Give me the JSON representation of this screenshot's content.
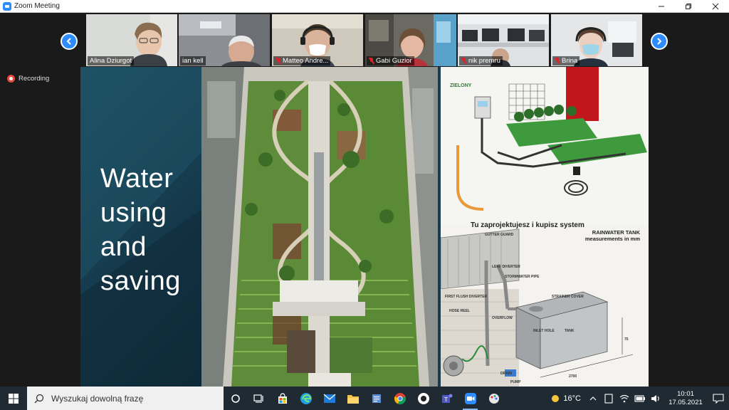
{
  "window": {
    "title": "Zoom Meeting"
  },
  "participants": [
    {
      "name": "Alina Dziurgot",
      "muted": false
    },
    {
      "name": "ian kell",
      "muted": false
    },
    {
      "name": "Matteo Andre...",
      "muted": true
    },
    {
      "name": "Gabi Guzior",
      "muted": true
    },
    {
      "name": "nik premru",
      "muted": true
    },
    {
      "name": "Brina",
      "muted": true
    }
  ],
  "recording": {
    "label": "Recording"
  },
  "slide": {
    "title_lines": [
      "Water",
      "using",
      "and",
      "saving"
    ],
    "diagram_top_caption": "Tu zaprojektujesz i kupisz system",
    "diagram_top_brand": "ZIELONY",
    "diagram_bottom_title": "RAINWATER TANK",
    "diagram_bottom_subtitle": "measurements in mm",
    "tank_labels": [
      "GUTTER GUARD",
      "LEAF DIVERTER",
      "STORMWATER PIPE",
      "FIRST FLUSH DIVERTER",
      "HOSE REEL",
      "OVERFLOW",
      "STRAINER COVER",
      "INLET HOLE",
      "TANK",
      "DRAIN",
      "PUMP",
      "2700",
      "75"
    ]
  },
  "taskbar": {
    "search_placeholder": "Wyszukaj dowolną frazę",
    "temperature": "16°C",
    "time": "10:01",
    "date": "17.05.2021"
  },
  "colors": {
    "zoom_blue": "#2d8cff",
    "slide_bg": "#173c4d",
    "taskbar": "#1f2a33",
    "muted_red": "#e0202a"
  }
}
